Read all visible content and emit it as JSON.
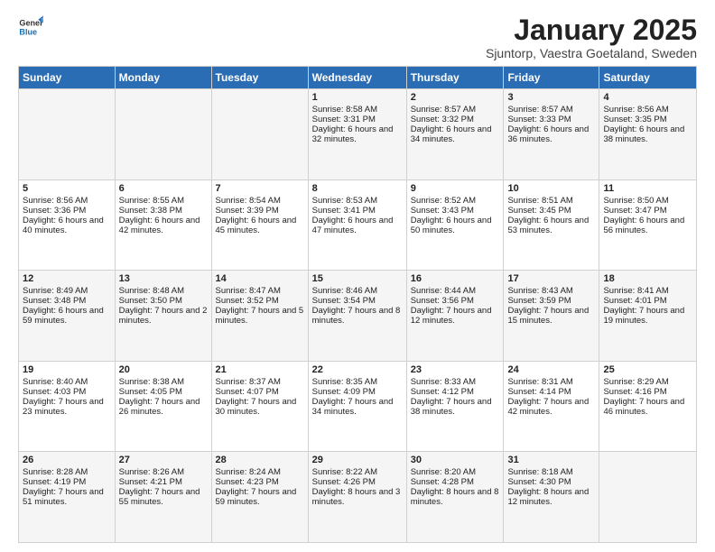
{
  "header": {
    "logo_general": "General",
    "logo_blue": "Blue",
    "month": "January 2025",
    "location": "Sjuntorp, Vaestra Goetaland, Sweden"
  },
  "days_of_week": [
    "Sunday",
    "Monday",
    "Tuesday",
    "Wednesday",
    "Thursday",
    "Friday",
    "Saturday"
  ],
  "weeks": [
    [
      {
        "day": "",
        "content": ""
      },
      {
        "day": "",
        "content": ""
      },
      {
        "day": "",
        "content": ""
      },
      {
        "day": "1",
        "content": "Sunrise: 8:58 AM\nSunset: 3:31 PM\nDaylight: 6 hours and 32 minutes."
      },
      {
        "day": "2",
        "content": "Sunrise: 8:57 AM\nSunset: 3:32 PM\nDaylight: 6 hours and 34 minutes."
      },
      {
        "day": "3",
        "content": "Sunrise: 8:57 AM\nSunset: 3:33 PM\nDaylight: 6 hours and 36 minutes."
      },
      {
        "day": "4",
        "content": "Sunrise: 8:56 AM\nSunset: 3:35 PM\nDaylight: 6 hours and 38 minutes."
      }
    ],
    [
      {
        "day": "5",
        "content": "Sunrise: 8:56 AM\nSunset: 3:36 PM\nDaylight: 6 hours and 40 minutes."
      },
      {
        "day": "6",
        "content": "Sunrise: 8:55 AM\nSunset: 3:38 PM\nDaylight: 6 hours and 42 minutes."
      },
      {
        "day": "7",
        "content": "Sunrise: 8:54 AM\nSunset: 3:39 PM\nDaylight: 6 hours and 45 minutes."
      },
      {
        "day": "8",
        "content": "Sunrise: 8:53 AM\nSunset: 3:41 PM\nDaylight: 6 hours and 47 minutes."
      },
      {
        "day": "9",
        "content": "Sunrise: 8:52 AM\nSunset: 3:43 PM\nDaylight: 6 hours and 50 minutes."
      },
      {
        "day": "10",
        "content": "Sunrise: 8:51 AM\nSunset: 3:45 PM\nDaylight: 6 hours and 53 minutes."
      },
      {
        "day": "11",
        "content": "Sunrise: 8:50 AM\nSunset: 3:47 PM\nDaylight: 6 hours and 56 minutes."
      }
    ],
    [
      {
        "day": "12",
        "content": "Sunrise: 8:49 AM\nSunset: 3:48 PM\nDaylight: 6 hours and 59 minutes."
      },
      {
        "day": "13",
        "content": "Sunrise: 8:48 AM\nSunset: 3:50 PM\nDaylight: 7 hours and 2 minutes."
      },
      {
        "day": "14",
        "content": "Sunrise: 8:47 AM\nSunset: 3:52 PM\nDaylight: 7 hours and 5 minutes."
      },
      {
        "day": "15",
        "content": "Sunrise: 8:46 AM\nSunset: 3:54 PM\nDaylight: 7 hours and 8 minutes."
      },
      {
        "day": "16",
        "content": "Sunrise: 8:44 AM\nSunset: 3:56 PM\nDaylight: 7 hours and 12 minutes."
      },
      {
        "day": "17",
        "content": "Sunrise: 8:43 AM\nSunset: 3:59 PM\nDaylight: 7 hours and 15 minutes."
      },
      {
        "day": "18",
        "content": "Sunrise: 8:41 AM\nSunset: 4:01 PM\nDaylight: 7 hours and 19 minutes."
      }
    ],
    [
      {
        "day": "19",
        "content": "Sunrise: 8:40 AM\nSunset: 4:03 PM\nDaylight: 7 hours and 23 minutes."
      },
      {
        "day": "20",
        "content": "Sunrise: 8:38 AM\nSunset: 4:05 PM\nDaylight: 7 hours and 26 minutes."
      },
      {
        "day": "21",
        "content": "Sunrise: 8:37 AM\nSunset: 4:07 PM\nDaylight: 7 hours and 30 minutes."
      },
      {
        "day": "22",
        "content": "Sunrise: 8:35 AM\nSunset: 4:09 PM\nDaylight: 7 hours and 34 minutes."
      },
      {
        "day": "23",
        "content": "Sunrise: 8:33 AM\nSunset: 4:12 PM\nDaylight: 7 hours and 38 minutes."
      },
      {
        "day": "24",
        "content": "Sunrise: 8:31 AM\nSunset: 4:14 PM\nDaylight: 7 hours and 42 minutes."
      },
      {
        "day": "25",
        "content": "Sunrise: 8:29 AM\nSunset: 4:16 PM\nDaylight: 7 hours and 46 minutes."
      }
    ],
    [
      {
        "day": "26",
        "content": "Sunrise: 8:28 AM\nSunset: 4:19 PM\nDaylight: 7 hours and 51 minutes."
      },
      {
        "day": "27",
        "content": "Sunrise: 8:26 AM\nSunset: 4:21 PM\nDaylight: 7 hours and 55 minutes."
      },
      {
        "day": "28",
        "content": "Sunrise: 8:24 AM\nSunset: 4:23 PM\nDaylight: 7 hours and 59 minutes."
      },
      {
        "day": "29",
        "content": "Sunrise: 8:22 AM\nSunset: 4:26 PM\nDaylight: 8 hours and 3 minutes."
      },
      {
        "day": "30",
        "content": "Sunrise: 8:20 AM\nSunset: 4:28 PM\nDaylight: 8 hours and 8 minutes."
      },
      {
        "day": "31",
        "content": "Sunrise: 8:18 AM\nSunset: 4:30 PM\nDaylight: 8 hours and 12 minutes."
      },
      {
        "day": "",
        "content": ""
      }
    ]
  ]
}
